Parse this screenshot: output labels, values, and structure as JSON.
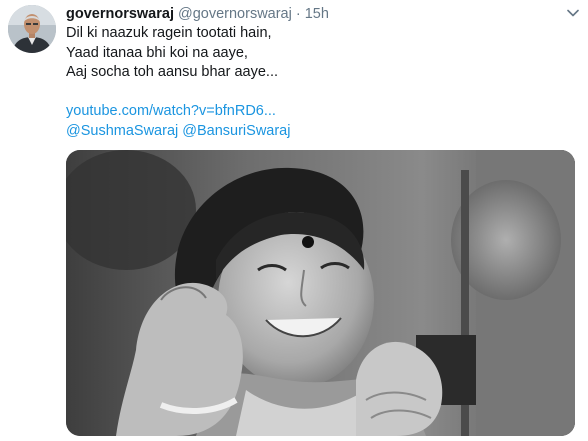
{
  "tweet": {
    "display_name": "governorswaraj",
    "handle": "@governorswaraj",
    "separator": "·",
    "timestamp": "15h",
    "lines": [
      "Dil ki naazuk ragein tootati hain,",
      "Yaad itanaa bhi koi na aaye,",
      "Aaj socha toh aansu bhar aaye..."
    ],
    "link": "youtube.com/watch?v=bfnRD6...",
    "mentions": [
      "@SushmaSwaraj",
      "@BansuriSwaraj"
    ]
  },
  "icons": {
    "avatar": "profile-photo",
    "menu": "chevron-down-icon",
    "media": "black-and-white-photo"
  },
  "colors": {
    "link": "#1b95e0",
    "secondary_text": "#657786",
    "primary_text": "#14171a"
  }
}
